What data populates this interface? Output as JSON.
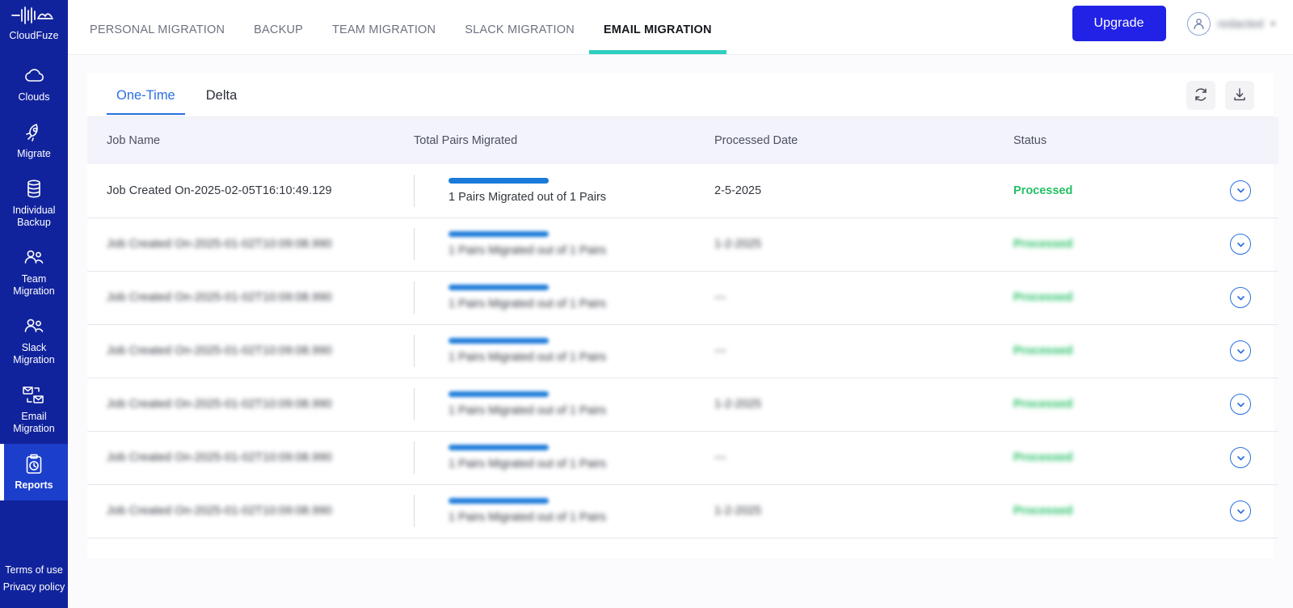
{
  "sidebar": {
    "brand": {
      "name": "CloudFuze",
      "logo_icon": "cloudfuze-logo-icon"
    },
    "items": [
      {
        "id": "clouds",
        "label": "Clouds",
        "icon": "cloud-icon",
        "active": false
      },
      {
        "id": "migrate",
        "label": "Migrate",
        "icon": "rocket-icon",
        "active": false
      },
      {
        "id": "individual-backup",
        "label": "Individual\nBackup",
        "icon": "database-icon",
        "active": false
      },
      {
        "id": "team-migration",
        "label": "Team\nMigration",
        "icon": "users-icon",
        "active": false
      },
      {
        "id": "slack-migration",
        "label": "Slack\nMigration",
        "icon": "users-icon",
        "active": false
      },
      {
        "id": "email-migration",
        "label": "Email\nMigration",
        "icon": "mail-swap-icon",
        "active": false
      },
      {
        "id": "reports",
        "label": "Reports",
        "icon": "clipboard-clock-icon",
        "active": true
      }
    ],
    "footer": [
      {
        "id": "terms",
        "label": "Terms of use"
      },
      {
        "id": "privacy",
        "label": "Privacy policy"
      }
    ]
  },
  "topbar": {
    "tabs": [
      {
        "id": "personal-migration",
        "label": "PERSONAL MIGRATION",
        "active": false
      },
      {
        "id": "backup",
        "label": "BACKUP",
        "active": false
      },
      {
        "id": "team-migration",
        "label": "TEAM MIGRATION",
        "active": false
      },
      {
        "id": "slack-migration",
        "label": "SLACK MIGRATION",
        "active": false
      },
      {
        "id": "email-migration",
        "label": "EMAIL MIGRATION",
        "active": true
      }
    ],
    "upgrade_label": "Upgrade",
    "user": {
      "name": "redacted",
      "caret": "▾",
      "avatar_icon": "user-avatar-icon"
    }
  },
  "panel": {
    "tabs": [
      {
        "id": "one-time",
        "label": "One-Time",
        "active": true
      },
      {
        "id": "delta",
        "label": "Delta",
        "active": false
      }
    ],
    "actions": [
      {
        "id": "refresh",
        "icon": "refresh-icon"
      },
      {
        "id": "download",
        "icon": "download-icon"
      }
    ]
  },
  "table": {
    "columns": [
      "Job Name",
      "Total Pairs Migrated",
      "Processed Date",
      "Status"
    ],
    "rows": [
      {
        "job_name": "Job Created On-2025-02-05T16:10:49.129",
        "pairs_text": "1 Pairs Migrated out of 1 Pairs",
        "progress_percent": 100,
        "date": "2-5-2025",
        "status": "Processed",
        "redacted": false
      },
      {
        "job_name": "Job Created On-2025-01-02T10:09:08.990",
        "pairs_text": "1 Pairs Migrated out of 1 Pairs",
        "progress_percent": 100,
        "date": "1-2-2025",
        "status": "Processed",
        "redacted": true
      },
      {
        "job_name": "Job Created On-2025-01-02T10:09:08.990",
        "pairs_text": "1 Pairs Migrated out of 1 Pairs",
        "progress_percent": 100,
        "date": "---",
        "status": "Processed",
        "redacted": true
      },
      {
        "job_name": "Job Created On-2025-01-02T10:09:08.990",
        "pairs_text": "1 Pairs Migrated out of 1 Pairs",
        "progress_percent": 100,
        "date": "---",
        "status": "Processed",
        "redacted": true
      },
      {
        "job_name": "Job Created On-2025-01-02T10:09:08.990",
        "pairs_text": "1 Pairs Migrated out of 1 Pairs",
        "progress_percent": 100,
        "date": "1-2-2025",
        "status": "Processed",
        "redacted": true
      },
      {
        "job_name": "Job Created On-2025-01-02T10:09:08.990",
        "pairs_text": "1 Pairs Migrated out of 1 Pairs",
        "progress_percent": 100,
        "date": "---",
        "status": "Processed",
        "redacted": true
      },
      {
        "job_name": "Job Created On-2025-01-02T10:09:08.990",
        "pairs_text": "1 Pairs Migrated out of 1 Pairs",
        "progress_percent": 100,
        "date": "1-2-2025",
        "status": "Processed",
        "redacted": true
      }
    ]
  },
  "colors": {
    "sidebar_bg": "#11239c",
    "sidebar_active_bg": "#1b3ecb",
    "upgrade_blue": "#2222e6",
    "tab_accent_teal": "#2ecfc0",
    "subtab_blue": "#2a6fe0",
    "progress_blue": "#1a7ad9",
    "status_green": "#25c065",
    "header_row_bg": "#f3f3fb"
  }
}
